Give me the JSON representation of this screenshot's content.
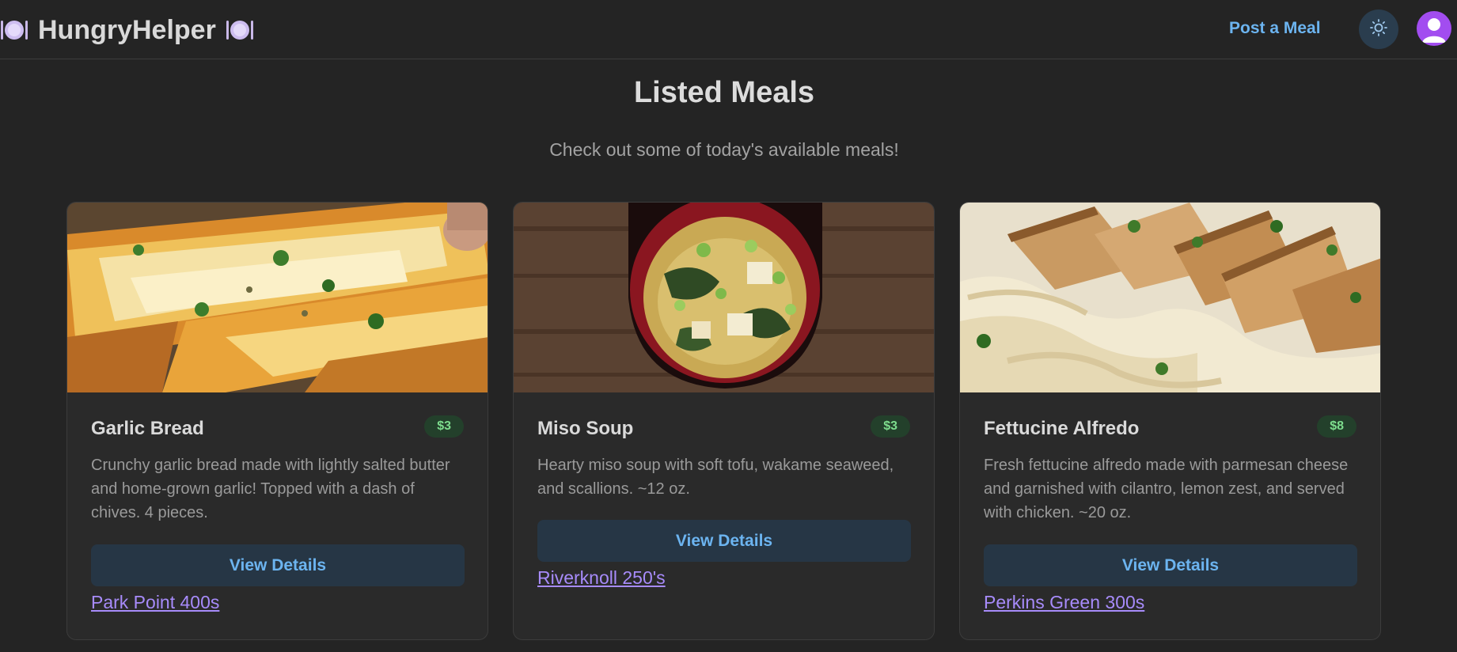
{
  "app": {
    "name": "HungryHelper",
    "logo_icon": "plate-icon"
  },
  "nav": {
    "post_meal_label": "Post a Meal",
    "theme_icon": "sun-icon",
    "avatar_icon": "user-icon"
  },
  "page": {
    "title": "Listed Meals",
    "subtitle": "Check out some of today's available meals!"
  },
  "colors": {
    "accent_blue": "#6cb4f0",
    "price_green": "#7ddc8d",
    "link_purple": "#a78bfa",
    "avatar_purple": "#a24df0"
  },
  "meals": [
    {
      "name": "Garlic Bread",
      "price": "$3",
      "description": "Crunchy garlic bread made with lightly salted butter and home-grown garlic! Topped with a dash of chives. 4 pieces.",
      "button_label": "View Details",
      "location": "Park Point 400s",
      "image": "garlic-bread-photo"
    },
    {
      "name": "Miso Soup",
      "price": "$3",
      "description": "Hearty miso soup with soft tofu, wakame seaweed, and scallions. ~12 oz.",
      "button_label": "View Details",
      "location": "Riverknoll 250's",
      "image": "miso-soup-photo"
    },
    {
      "name": "Fettucine Alfredo",
      "price": "$8",
      "description": "Fresh fettucine alfredo made with parmesan cheese and garnished with cilantro, lemon zest, and served with chicken. ~20 oz.",
      "button_label": "View Details",
      "location": "Perkins Green 300s",
      "image": "fettucine-alfredo-photo"
    }
  ]
}
